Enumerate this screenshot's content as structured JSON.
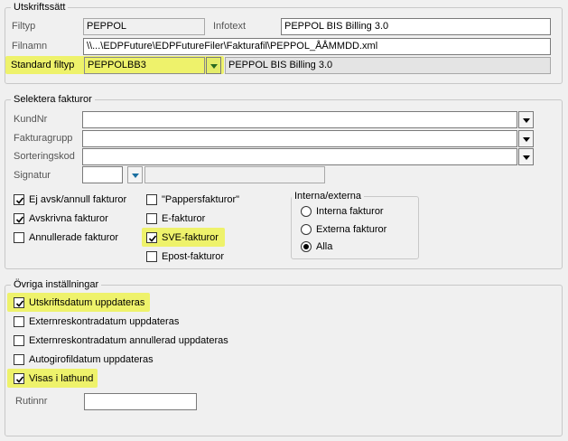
{
  "colors": {
    "highlight": "#eef26b",
    "window_bg": "#f0f0f0",
    "accent_dropdown": "#1a6fa0"
  },
  "utskrift": {
    "title": "Utskriftssätt",
    "filtyp_label": "Filtyp",
    "filtyp_value": "PEPPOL",
    "infotext_label": "Infotext",
    "infotext_value": "PEPPOL BIS Billing 3.0",
    "filnamn_label": "Filnamn",
    "filnamn_value": "\\\\...\\EDPFuture\\EDPFutureFiler\\Fakturafil\\PEPPOL_ÅÅMMDD.xml",
    "standard_label": "Standard filtyp",
    "standard_value": "PEPPOLBB3",
    "standard_desc": "PEPPOL BIS Billing 3.0"
  },
  "selektera": {
    "title": "Selektera fakturor",
    "kundnr_label": "KundNr",
    "kundnr_value": "",
    "fakturagrupp_label": "Fakturagrupp",
    "fakturagrupp_value": "",
    "sortering_label": "Sorteringskod",
    "sortering_value": "",
    "signatur_label": "Signatur",
    "signatur_value": "",
    "checkboxes_col1": [
      {
        "label": "Ej avsk/annull fakturor",
        "checked": true
      },
      {
        "label": "Avskrivna fakturor",
        "checked": true
      },
      {
        "label": "Annullerade fakturor",
        "checked": false
      }
    ],
    "checkboxes_col2": [
      {
        "label": "\"Pappersfakturor\"",
        "checked": false
      },
      {
        "label": "E-fakturor",
        "checked": false
      },
      {
        "label": "SVE-fakturor",
        "checked": true
      },
      {
        "label": "Epost-fakturor",
        "checked": false
      }
    ],
    "interna_title": "Interna/externa",
    "radios": [
      {
        "label": "Interna fakturor",
        "selected": false
      },
      {
        "label": "Externa fakturor",
        "selected": false
      },
      {
        "label": "Alla",
        "selected": true
      }
    ]
  },
  "ovriga": {
    "title": "Övriga inställningar",
    "checkboxes": [
      {
        "label": "Utskriftsdatum uppdateras",
        "checked": true
      },
      {
        "label": "Externreskontradatum uppdateras",
        "checked": false
      },
      {
        "label": "Externreskontradatum annullerad uppdateras",
        "checked": false
      },
      {
        "label": "Autogirofildatum uppdateras",
        "checked": false
      },
      {
        "label": "Visas i lathund",
        "checked": true
      }
    ],
    "rutinnr_label": "Rutinnr",
    "rutinnr_value": ""
  }
}
